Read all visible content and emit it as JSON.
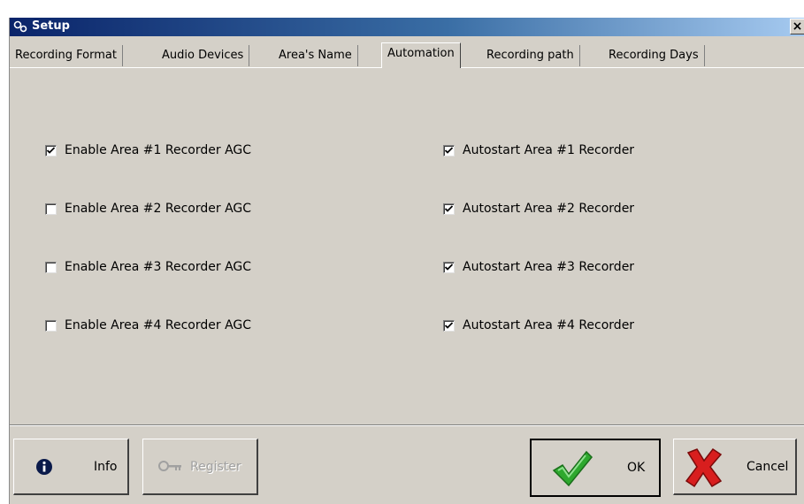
{
  "window": {
    "title": "Setup",
    "close_glyph": "×"
  },
  "tabs": [
    {
      "label": "Recording Format",
      "active": false
    },
    {
      "label": "Audio Devices",
      "active": false
    },
    {
      "label": "Area's Name",
      "active": false
    },
    {
      "label": "Automation",
      "active": true
    },
    {
      "label": "Recording path",
      "active": false
    },
    {
      "label": "Recording Days",
      "active": false
    }
  ],
  "agc": [
    {
      "label": "Enable Area #1 Recorder AGC",
      "checked": true
    },
    {
      "label": "Enable Area #2 Recorder AGC",
      "checked": false
    },
    {
      "label": "Enable Area #3 Recorder AGC",
      "checked": false
    },
    {
      "label": "Enable Area #4 Recorder AGC",
      "checked": false
    }
  ],
  "autostart": [
    {
      "label": "Autostart Area #1 Recorder",
      "checked": true
    },
    {
      "label": "Autostart Area #2 Recorder",
      "checked": true
    },
    {
      "label": "Autostart Area #3 Recorder",
      "checked": true
    },
    {
      "label": "Autostart Area #4 Recorder",
      "checked": true
    }
  ],
  "buttons": {
    "info": "Info",
    "register": "Register",
    "ok": "OK",
    "cancel": "Cancel"
  },
  "icons": {
    "title": "gears-icon",
    "info": "info-icon",
    "register": "key-icon",
    "ok": "checkmark-icon",
    "cancel": "x-icon"
  },
  "colors": {
    "titlebar_start": "#0a246a",
    "titlebar_end": "#a6caf0",
    "dialog_bg": "#d4d0c8",
    "ok_green": "#2ea82e",
    "cancel_red": "#d81e1e"
  }
}
